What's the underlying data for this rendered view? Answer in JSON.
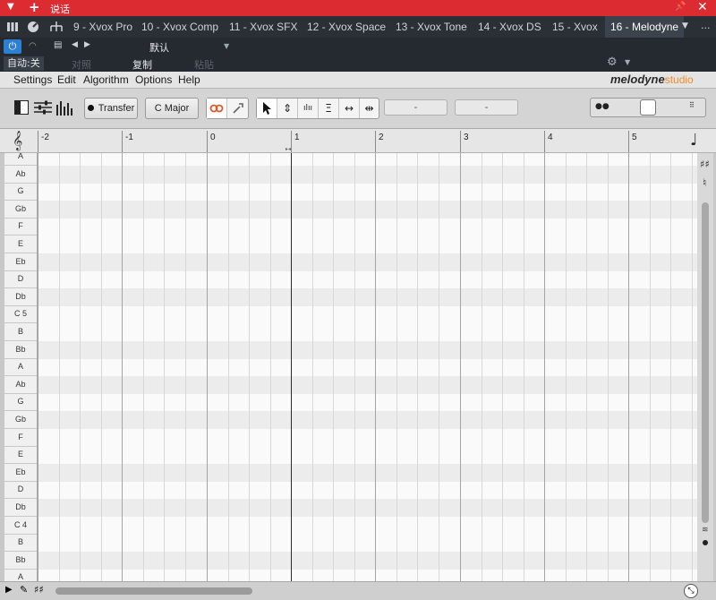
{
  "titlebar": {
    "title": "说话",
    "pin_icon": "pin-icon",
    "close_icon": "close-icon"
  },
  "tabs": [
    {
      "label": "9 - Xvox Pro"
    },
    {
      "label": "10 - Xvox Comp"
    },
    {
      "label": "11 - Xvox SFX"
    },
    {
      "label": "12 - Xvox Space"
    },
    {
      "label": "13 - Xvox Tone"
    },
    {
      "label": "14 - Xvox DS"
    },
    {
      "label": "15 - Xvox"
    },
    {
      "label": "16 - Melodyne",
      "active": true
    }
  ],
  "tabstrip": {
    "more": "..."
  },
  "preset": {
    "name": "默认"
  },
  "autobar": {
    "auto": "自动:关",
    "compare": "对照",
    "copy": "复制",
    "paste": "粘贴"
  },
  "menu": [
    "Settings",
    "Edit",
    "Algorithm",
    "Options",
    "Help"
  ],
  "logo": {
    "brand": "melodyne",
    "edition": "studio"
  },
  "toolbar": {
    "transfer_label": "Transfer",
    "scale_label": "C Major",
    "field1": "-",
    "field2": "-"
  },
  "ruler": {
    "labels": [
      "-2",
      "-1",
      "0",
      "1",
      "2",
      "3",
      "4",
      "5"
    ]
  },
  "pitches": [
    "A",
    "Ab",
    "G",
    "Gb",
    "F",
    "E",
    "Eb",
    "D",
    "Db",
    "C 5",
    "B",
    "Bb",
    "A",
    "Ab",
    "G",
    "Gb",
    "F",
    "E",
    "Eb",
    "D",
    "Db",
    "C 4",
    "B",
    "Bb",
    "A"
  ],
  "colors": {
    "titlebar": "#dc2b31",
    "accent": "#2d7fd1",
    "logo_studio": "#f08a2a"
  }
}
